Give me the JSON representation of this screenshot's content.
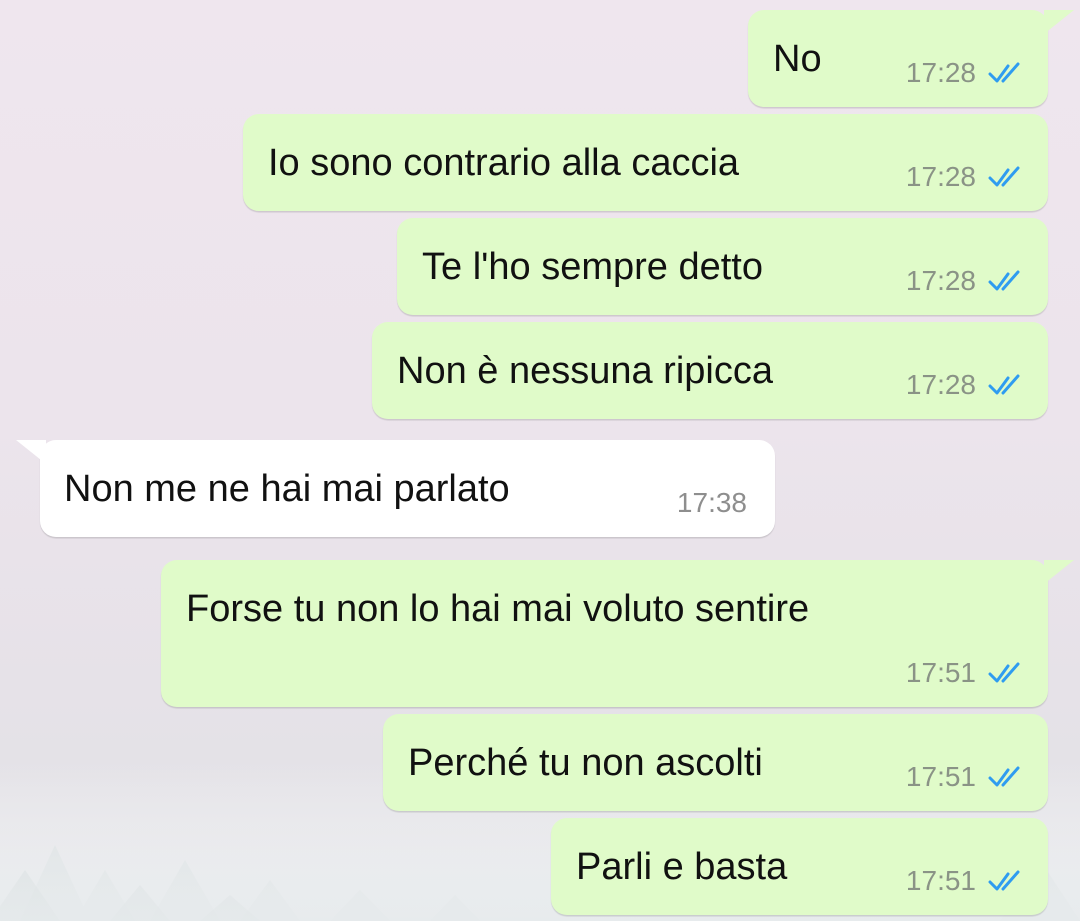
{
  "chat": {
    "messages": [
      {
        "direction": "outgoing",
        "text": "No",
        "time": "17:28",
        "status_icon": "double-check-read-icon"
      },
      {
        "direction": "outgoing",
        "text": "Io sono contrario alla caccia",
        "time": "17:28",
        "status_icon": "double-check-read-icon"
      },
      {
        "direction": "outgoing",
        "text": "Te l'ho sempre detto",
        "time": "17:28",
        "status_icon": "double-check-read-icon"
      },
      {
        "direction": "outgoing",
        "text": "Non è nessuna ripicca",
        "time": "17:28",
        "status_icon": "double-check-read-icon"
      },
      {
        "direction": "incoming",
        "text": "Non me ne hai mai parlato",
        "time": "17:38"
      },
      {
        "direction": "outgoing",
        "text": "Forse tu non lo hai mai voluto sentire",
        "time": "17:51",
        "status_icon": "double-check-read-icon"
      },
      {
        "direction": "outgoing",
        "text": "Perché tu non ascolti",
        "time": "17:51",
        "status_icon": "double-check-read-icon"
      },
      {
        "direction": "outgoing",
        "text": "Parli e basta",
        "time": "17:51",
        "status_icon": "double-check-read-icon"
      }
    ]
  },
  "colors": {
    "outgoing_bubble": "#e0fbc9",
    "incoming_bubble": "#ffffff",
    "read_ticks": "#2f9cf0",
    "timestamp": "#8a9386"
  }
}
